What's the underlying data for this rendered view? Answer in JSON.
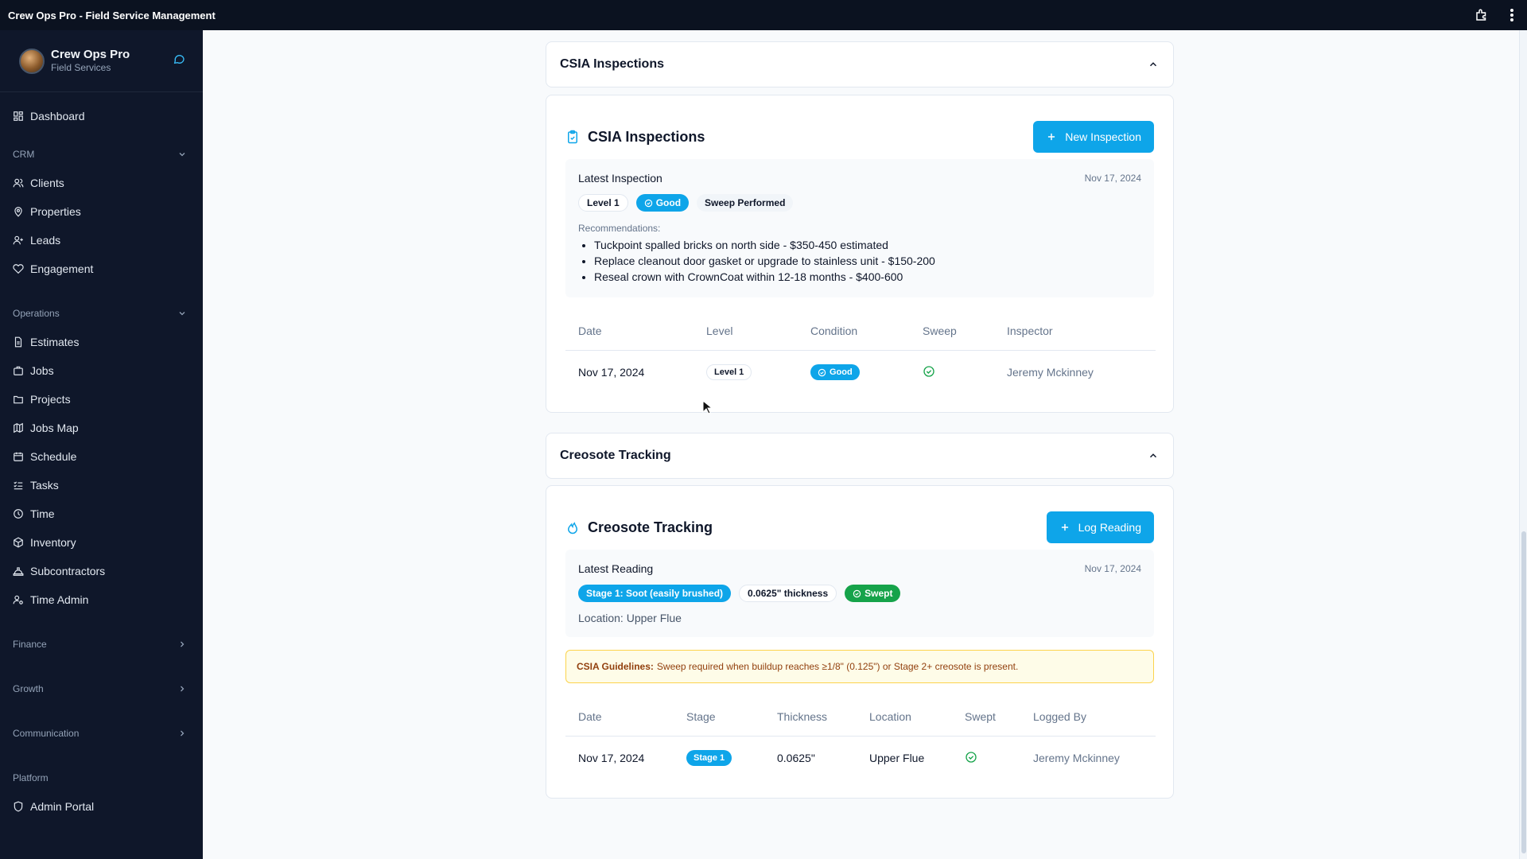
{
  "window": {
    "title": "Crew Ops Pro - Field Service Management"
  },
  "brand": {
    "name": "Crew Ops Pro",
    "subtitle": "Field Services"
  },
  "sidebar": {
    "dashboard": "Dashboard",
    "sections": {
      "crm": "CRM",
      "operations": "Operations",
      "finance": "Finance",
      "growth": "Growth",
      "communication": "Communication",
      "platform": "Platform"
    },
    "crm_items": [
      "Clients",
      "Properties",
      "Leads",
      "Engagement"
    ],
    "operations_items": [
      "Estimates",
      "Jobs",
      "Projects",
      "Jobs Map",
      "Schedule",
      "Tasks",
      "Time",
      "Inventory",
      "Subcontractors",
      "Time Admin"
    ],
    "platform_items": [
      "Admin Portal"
    ]
  },
  "csia": {
    "section_title": "CSIA Inspections",
    "panel_title": "CSIA Inspections",
    "new_button": "New Inspection",
    "latest": {
      "label": "Latest Inspection",
      "date": "Nov 17, 2024",
      "level": "Level 1",
      "condition": "Good",
      "sweep": "Sweep Performed",
      "recommendations_label": "Recommendations:",
      "recommendations": [
        "Tuckpoint spalled bricks on north side - $350-450 estimated",
        "Replace cleanout door gasket or upgrade to stainless unit - $150-200",
        "Reseal crown with CrownCoat within 12-18 months - $400-600"
      ]
    },
    "table": {
      "headers": [
        "Date",
        "Level",
        "Condition",
        "Sweep",
        "Inspector"
      ],
      "rows": [
        {
          "date": "Nov 17, 2024",
          "level": "Level 1",
          "condition": "Good",
          "sweep": true,
          "inspector": "Jeremy Mckinney"
        }
      ]
    }
  },
  "creosote": {
    "section_title": "Creosote Tracking",
    "panel_title": "Creosote Tracking",
    "log_button": "Log Reading",
    "latest": {
      "label": "Latest Reading",
      "date": "Nov 17, 2024",
      "stage": "Stage 1: Soot (easily brushed)",
      "thickness": "0.0625\" thickness",
      "swept": "Swept",
      "location": "Location: Upper Flue"
    },
    "guidelines": {
      "label": "CSIA Guidelines:",
      "text": "Sweep required when buildup reaches ≥1/8\" (0.125\") or Stage 2+ creosote is present."
    },
    "table": {
      "headers": [
        "Date",
        "Stage",
        "Thickness",
        "Location",
        "Swept",
        "Logged By"
      ],
      "rows": [
        {
          "date": "Nov 17, 2024",
          "stage": "Stage 1",
          "thickness": "0.0625\"",
          "location": "Upper Flue",
          "swept": true,
          "logged_by": "Jeremy Mckinney"
        }
      ]
    }
  },
  "colors": {
    "accent": "#0ea5e9",
    "success": "#16a34a",
    "sidebar": "#0f172a"
  }
}
